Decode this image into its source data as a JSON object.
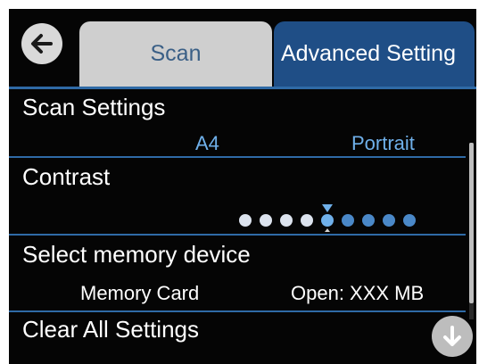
{
  "header": {
    "tabs": [
      {
        "label": "Scan",
        "active": false
      },
      {
        "label": "Advanced Setting",
        "active": true
      }
    ]
  },
  "settings": {
    "scan_settings": {
      "title": "Scan Settings",
      "size": "A4",
      "orientation": "Portrait"
    },
    "contrast": {
      "title": "Contrast",
      "level": 5,
      "levels": 9
    },
    "memory": {
      "title": "Select memory device",
      "device": "Memory Card",
      "open": "Open: XXX MB"
    },
    "clear": {
      "title": "Clear All Settings"
    }
  },
  "icons": {
    "back": "arrow-left-icon",
    "scroll_down": "arrow-down-icon"
  },
  "colors": {
    "accent": "#2f6aa6",
    "active_tab": "#1f4e86",
    "value_text": "#6fb0ea",
    "dot_inactive": "#dce3ee"
  }
}
